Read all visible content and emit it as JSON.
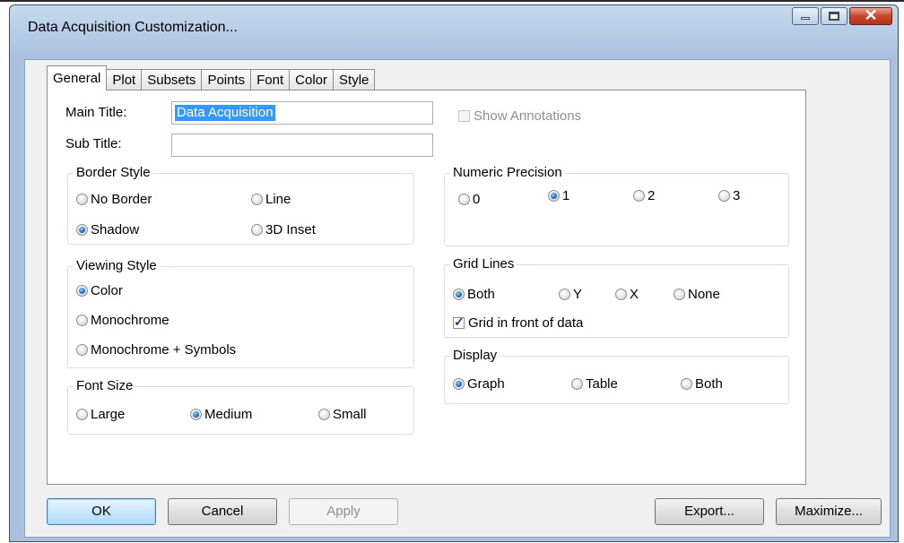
{
  "window": {
    "title": "Data Acquisition Customization..."
  },
  "tabs": [
    "General",
    "Plot",
    "Subsets",
    "Points",
    "Font",
    "Color",
    "Style"
  ],
  "general": {
    "main_title_label": "Main Title:",
    "main_title_value": "Data Acquisition",
    "sub_title_label": "Sub Title:",
    "sub_title_value": "",
    "show_annotations": {
      "label": "Show Annotations",
      "checked": false,
      "enabled": false
    },
    "border_style": {
      "title": "Border Style",
      "options": [
        "No Border",
        "Line",
        "Shadow",
        "3D Inset"
      ],
      "selected": "Shadow"
    },
    "viewing_style": {
      "title": "Viewing Style",
      "options": [
        "Color",
        "Monochrome",
        "Monochrome + Symbols"
      ],
      "selected": "Color"
    },
    "font_size": {
      "title": "Font Size",
      "options": [
        "Large",
        "Medium",
        "Small"
      ],
      "selected": "Medium"
    },
    "numeric_precision": {
      "title": "Numeric Precision",
      "options": [
        "0",
        "1",
        "2",
        "3"
      ],
      "selected": "1"
    },
    "grid_lines": {
      "title": "Grid Lines",
      "options": [
        "Both",
        "Y",
        "X",
        "None"
      ],
      "selected": "Both",
      "grid_in_front": {
        "label": "Grid in front of data",
        "checked": true
      }
    },
    "display": {
      "title": "Display",
      "options": [
        "Graph",
        "Table",
        "Both"
      ],
      "selected": "Graph"
    }
  },
  "buttons": {
    "ok": "OK",
    "cancel": "Cancel",
    "apply": "Apply",
    "export": "Export...",
    "maximize": "Maximize..."
  }
}
